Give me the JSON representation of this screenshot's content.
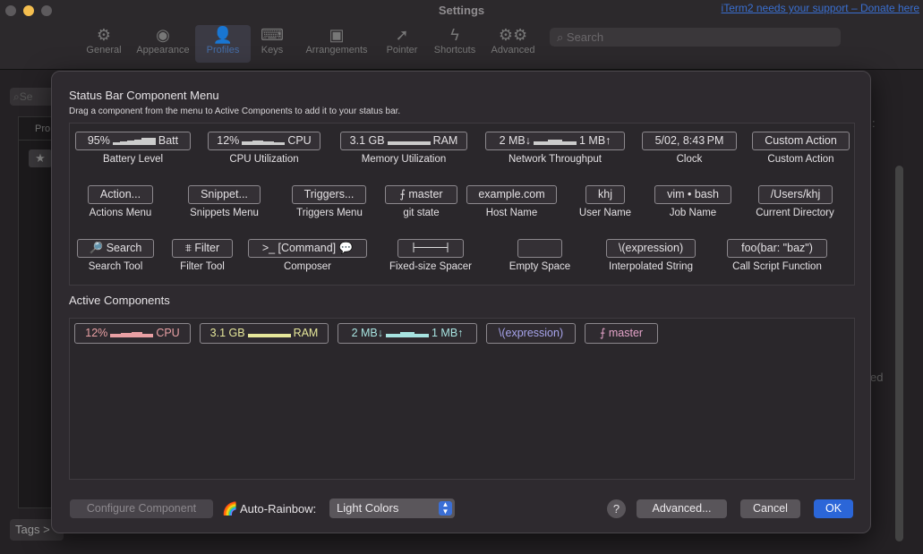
{
  "window": {
    "title": "Settings",
    "donate_link": "iTerm2 needs your support – Donate here"
  },
  "toolbar": {
    "items": [
      {
        "label": "General",
        "icon": "gear-icon"
      },
      {
        "label": "Appearance",
        "icon": "eye-icon"
      },
      {
        "label": "Profiles",
        "icon": "person-icon",
        "selected": true
      },
      {
        "label": "Keys",
        "icon": "keyboard-icon"
      },
      {
        "label": "Arrangements",
        "icon": "window-icon"
      },
      {
        "label": "Pointer",
        "icon": "cursor-icon"
      },
      {
        "label": "Shortcuts",
        "icon": "bolt-icon"
      },
      {
        "label": "Advanced",
        "icon": "gears-icon"
      }
    ],
    "search_placeholder": "Search"
  },
  "background": {
    "search_placeholder": "Se",
    "list_header": "Pro",
    "tags_button": "Tags >",
    "partial_text": "ed",
    "colon": ":"
  },
  "sheet": {
    "title": "Status Bar Component Menu",
    "subtitle": "Drag a component from the menu to Active Components to add it to your status bar.",
    "components": [
      {
        "sample_left": "95%",
        "sample_right": "Batt",
        "label": "Battery Level"
      },
      {
        "sample_left": "12%",
        "sample_right": "CPU",
        "label": "CPU Utilization"
      },
      {
        "sample_left": "3.1 GB",
        "sample_right": "RAM",
        "label": "Memory Utilization"
      },
      {
        "sample_left": "2 MB↓",
        "sample_right": "1 MB↑",
        "label": "Network Throughput"
      },
      {
        "sample": "5/02, 8:43 PM",
        "label": "Clock"
      },
      {
        "sample": "Custom Action",
        "label": "Custom Action"
      },
      {
        "sample": "Action...",
        "label": "Actions Menu"
      },
      {
        "sample": "Snippet...",
        "label": "Snippets Menu"
      },
      {
        "sample": "Triggers...",
        "label": "Triggers Menu"
      },
      {
        "sample": "⨍ master",
        "label": "git state"
      },
      {
        "sample": "example.com",
        "label": "Host Name"
      },
      {
        "sample": "khj",
        "label": "User Name"
      },
      {
        "sample": "vim • bash",
        "label": "Job Name"
      },
      {
        "sample": "/Users/khj",
        "label": "Current Directory"
      },
      {
        "sample": "🔎 Search",
        "label": "Search Tool"
      },
      {
        "sample": "⩨ Filter",
        "label": "Filter Tool"
      },
      {
        "sample": ">_ [Command] 💬",
        "label": "Composer"
      },
      {
        "sample": "",
        "label": "Fixed-size Spacer"
      },
      {
        "sample": "",
        "label": "Empty Space"
      },
      {
        "sample": "\\(expression)",
        "label": "Interpolated String"
      },
      {
        "sample": "foo(bar: \"baz\")",
        "label": "Call Script Function"
      }
    ],
    "active_title": "Active Components",
    "active": [
      {
        "left": "12%",
        "right": "CPU",
        "color": "#e9a0a4"
      },
      {
        "left": "3.1 GB",
        "right": "RAM",
        "color": "#e6e79a"
      },
      {
        "left": "2 MB↓",
        "right": "1 MB↑",
        "color": "#a7e3e0"
      },
      {
        "text": "\\(expression)",
        "color": "#a7a4ec"
      },
      {
        "text": "⨍ master",
        "color": "#e4a3c9"
      }
    ],
    "configure_button": "Configure Component",
    "rainbow_icon": "🌈",
    "rainbow_label": "Auto-Rainbow:",
    "rainbow_value": "Light Colors",
    "help_button": "?",
    "advanced_button": "Advanced...",
    "cancel_button": "Cancel",
    "ok_button": "OK"
  }
}
